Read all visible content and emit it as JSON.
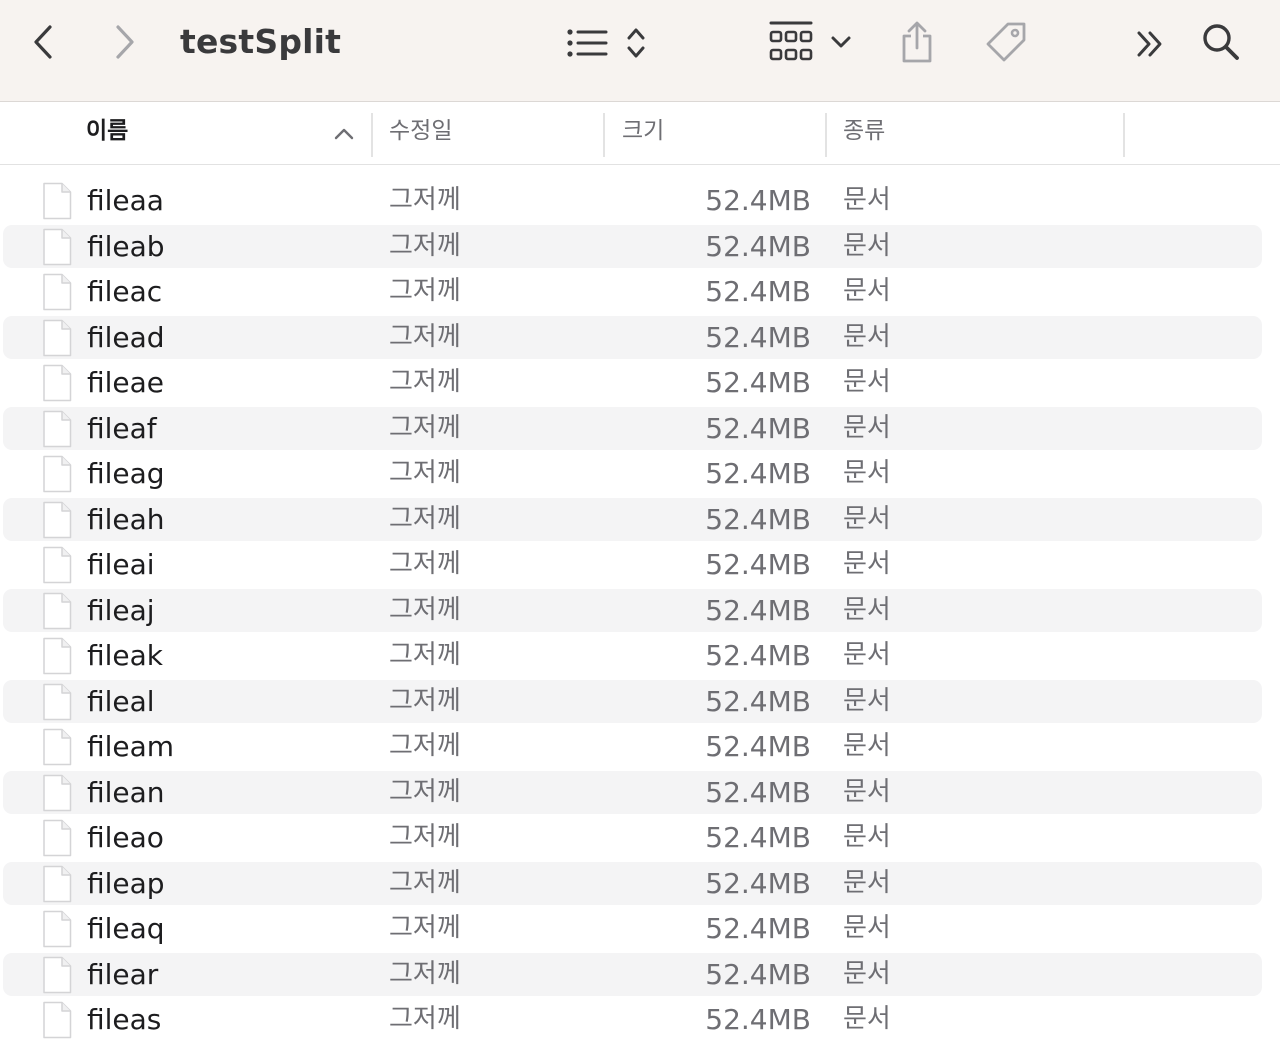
{
  "window": {
    "title": "testSplit"
  },
  "toolbar": {
    "icons": [
      "back-icon",
      "forward-icon",
      "list-view-icon",
      "sort-chevrons-icon",
      "grid-group-icon",
      "chevron-down-icon",
      "share-icon",
      "tag-icon",
      "more-icon",
      "search-icon"
    ]
  },
  "columns": {
    "name": "이름",
    "modified": "수정일",
    "size": "크기",
    "kind": "종류"
  },
  "files": [
    {
      "name": "fileaa",
      "modified": "그저께",
      "size": "52.4MB",
      "kind": "문서"
    },
    {
      "name": "fileab",
      "modified": "그저께",
      "size": "52.4MB",
      "kind": "문서"
    },
    {
      "name": "fileac",
      "modified": "그저께",
      "size": "52.4MB",
      "kind": "문서"
    },
    {
      "name": "filead",
      "modified": "그저께",
      "size": "52.4MB",
      "kind": "문서"
    },
    {
      "name": "fileae",
      "modified": "그저께",
      "size": "52.4MB",
      "kind": "문서"
    },
    {
      "name": "fileaf",
      "modified": "그저께",
      "size": "52.4MB",
      "kind": "문서"
    },
    {
      "name": "fileag",
      "modified": "그저께",
      "size": "52.4MB",
      "kind": "문서"
    },
    {
      "name": "fileah",
      "modified": "그저께",
      "size": "52.4MB",
      "kind": "문서"
    },
    {
      "name": "fileai",
      "modified": "그저께",
      "size": "52.4MB",
      "kind": "문서"
    },
    {
      "name": "fileaj",
      "modified": "그저께",
      "size": "52.4MB",
      "kind": "문서"
    },
    {
      "name": "fileak",
      "modified": "그저께",
      "size": "52.4MB",
      "kind": "문서"
    },
    {
      "name": "fileal",
      "modified": "그저께",
      "size": "52.4MB",
      "kind": "문서"
    },
    {
      "name": "fileam",
      "modified": "그저께",
      "size": "52.4MB",
      "kind": "문서"
    },
    {
      "name": "filean",
      "modified": "그저께",
      "size": "52.4MB",
      "kind": "문서"
    },
    {
      "name": "fileao",
      "modified": "그저께",
      "size": "52.4MB",
      "kind": "문서"
    },
    {
      "name": "fileap",
      "modified": "그저께",
      "size": "52.4MB",
      "kind": "문서"
    },
    {
      "name": "fileaq",
      "modified": "그저께",
      "size": "52.4MB",
      "kind": "문서"
    },
    {
      "name": "filear",
      "modified": "그저께",
      "size": "52.4MB",
      "kind": "문서"
    },
    {
      "name": "fileas",
      "modified": "그저께",
      "size": "52.4MB",
      "kind": "문서"
    }
  ]
}
